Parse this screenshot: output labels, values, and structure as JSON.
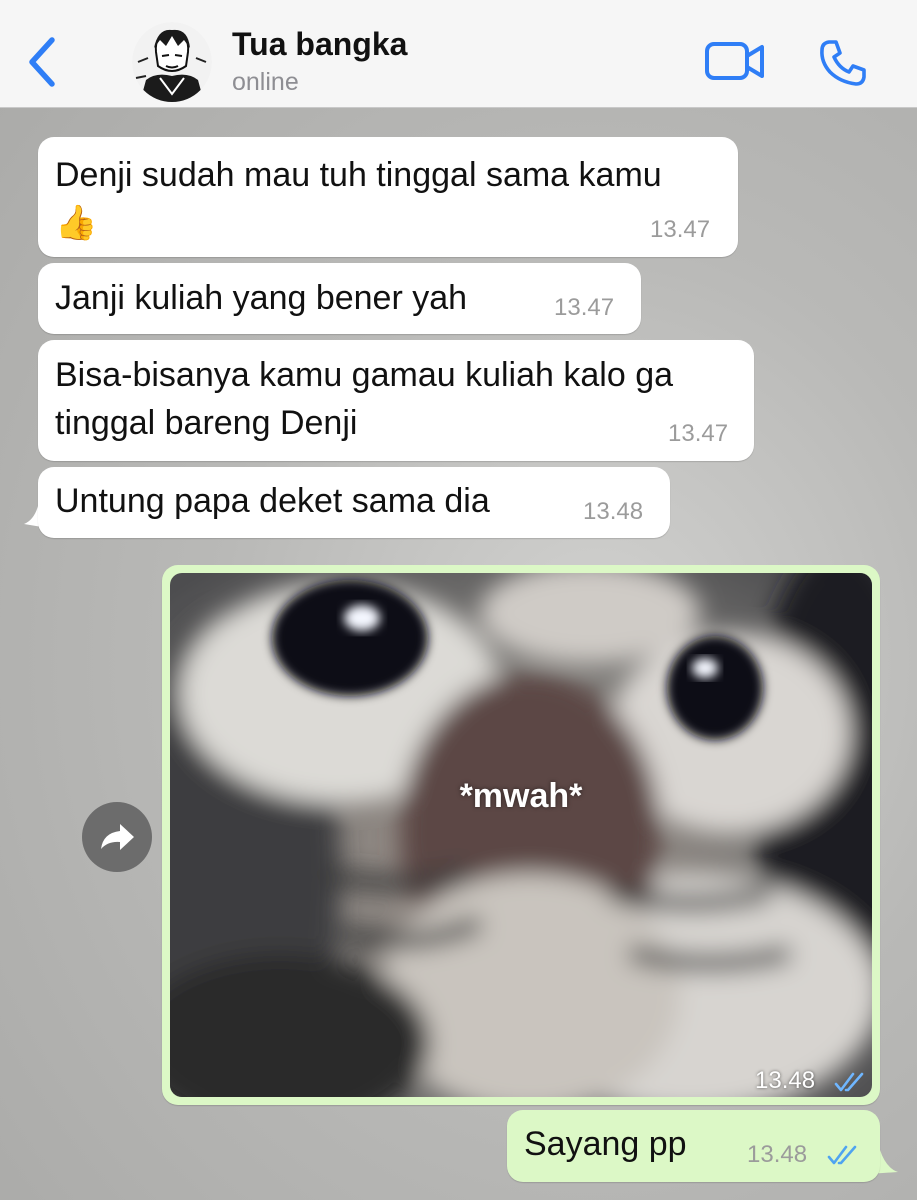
{
  "header": {
    "contact_name": "Tua bangka",
    "status": "online",
    "accent_color": "#2f7ef6"
  },
  "messages": [
    {
      "direction": "incoming",
      "text_lines": [
        "Denji sudah mau tuh tinggal sama kamu",
        "👍"
      ],
      "time": "13.47"
    },
    {
      "direction": "incoming",
      "text_lines": [
        "Janji kuliah yang bener yah"
      ],
      "time": "13.47"
    },
    {
      "direction": "incoming",
      "text_lines": [
        "Bisa-bisanya kamu gamau kuliah kalo ga",
        "tinggal bareng Denji"
      ],
      "time": "13.47"
    },
    {
      "direction": "incoming",
      "text_lines": [
        "Untung papa deket sama dia"
      ],
      "time": "13.48"
    },
    {
      "direction": "outgoing",
      "type": "image",
      "image_caption": "*mwah*",
      "time": "13.48",
      "status": "read"
    },
    {
      "direction": "outgoing",
      "text_lines": [
        "Sayang pp"
      ],
      "time": "13.48",
      "status": "read"
    }
  ],
  "colors": {
    "incoming_bubble": "#ffffff",
    "outgoing_bubble": "#dcf8c6",
    "read_ticks": "#4fa4f0",
    "timestamp": "#9b9b9b"
  },
  "icons": {
    "back": "chevron-left-icon",
    "video": "video-camera-icon",
    "call": "phone-icon",
    "forward": "forward-arrow-icon",
    "read_receipt": "double-check-icon"
  }
}
